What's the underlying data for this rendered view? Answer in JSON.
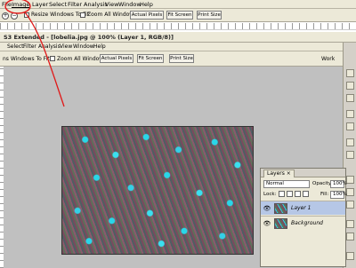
{
  "menubar_top": {
    "items": [
      "File",
      "Image",
      "Layer",
      "Select",
      "Filter",
      "Analysis",
      "View",
      "Window",
      "Help"
    ]
  },
  "options_top": {
    "resize_label": "Resize Windows To Fit",
    "zoom_all_label": "Zoom All Windows",
    "actual_pixels": "Actual Pixels",
    "fit_screen": "Fit Screen",
    "print_size": "Print Size"
  },
  "document": {
    "title": "S3 Extended - [lobelia.jpg @ 100% (Layer 1, RGB/8)]"
  },
  "menubar_doc": {
    "items": [
      "Select",
      "Filter",
      "Analysis",
      "View",
      "Window",
      "Help"
    ]
  },
  "options_doc": {
    "resize_label": "ns Windows To Fit",
    "zoom_all_label": "Zoom All Windows",
    "actual_pixels": "Actual Pixels",
    "fit_screen": "Fit Screen",
    "print_size": "Print Size",
    "workspace": "Work"
  },
  "layers_panel": {
    "tab": "Layers ×",
    "blend_mode": "Normal",
    "opacity_label": "Opacity:",
    "opacity_value": "100%",
    "lock_label": "Lock:",
    "fill_label": "Fill:",
    "fill_value": "100%",
    "layers": [
      {
        "name": "Layer 1",
        "selected": true
      },
      {
        "name": "Background",
        "selected": false
      }
    ]
  },
  "colors": {
    "annotation": "#e01818",
    "selected_layer": "#b6c7e6"
  }
}
